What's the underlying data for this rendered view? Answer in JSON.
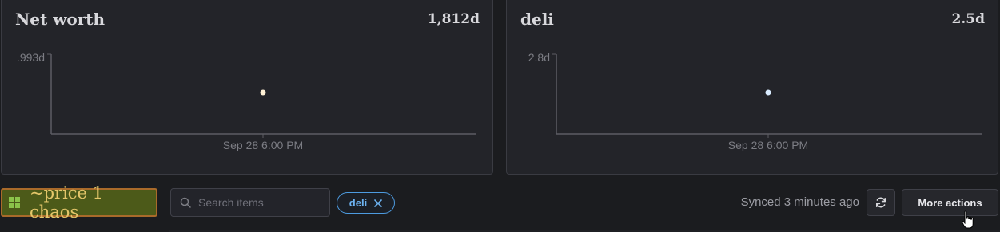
{
  "networth": {
    "title": "Net worth",
    "value": "1,812d",
    "y_tick": ".993d",
    "x_tick": "Sep 28 6:00 PM",
    "point_color": "#fff1d6"
  },
  "deli": {
    "title": "deli",
    "value": "2.5d",
    "y_tick": "2.8d",
    "x_tick": "Sep 28 6:00 PM",
    "point_color": "#d9ecff"
  },
  "toolbar": {
    "price_badge_label": "~price 1 chaos",
    "search_placeholder": "Search items",
    "search_value": "",
    "filter_chip_label": "deli",
    "sync_status": "Synced 3 minutes ago",
    "more_actions_label": "More actions"
  },
  "colors": {
    "accent_blue": "#4d9be0",
    "badge_background": "#4c5a19",
    "badge_border": "#a96a2a",
    "badge_text": "#e4c66a"
  },
  "icons": {
    "badge": "grid-icon",
    "search": "search-icon",
    "chip_remove": "close-icon",
    "refresh": "refresh-icon"
  }
}
